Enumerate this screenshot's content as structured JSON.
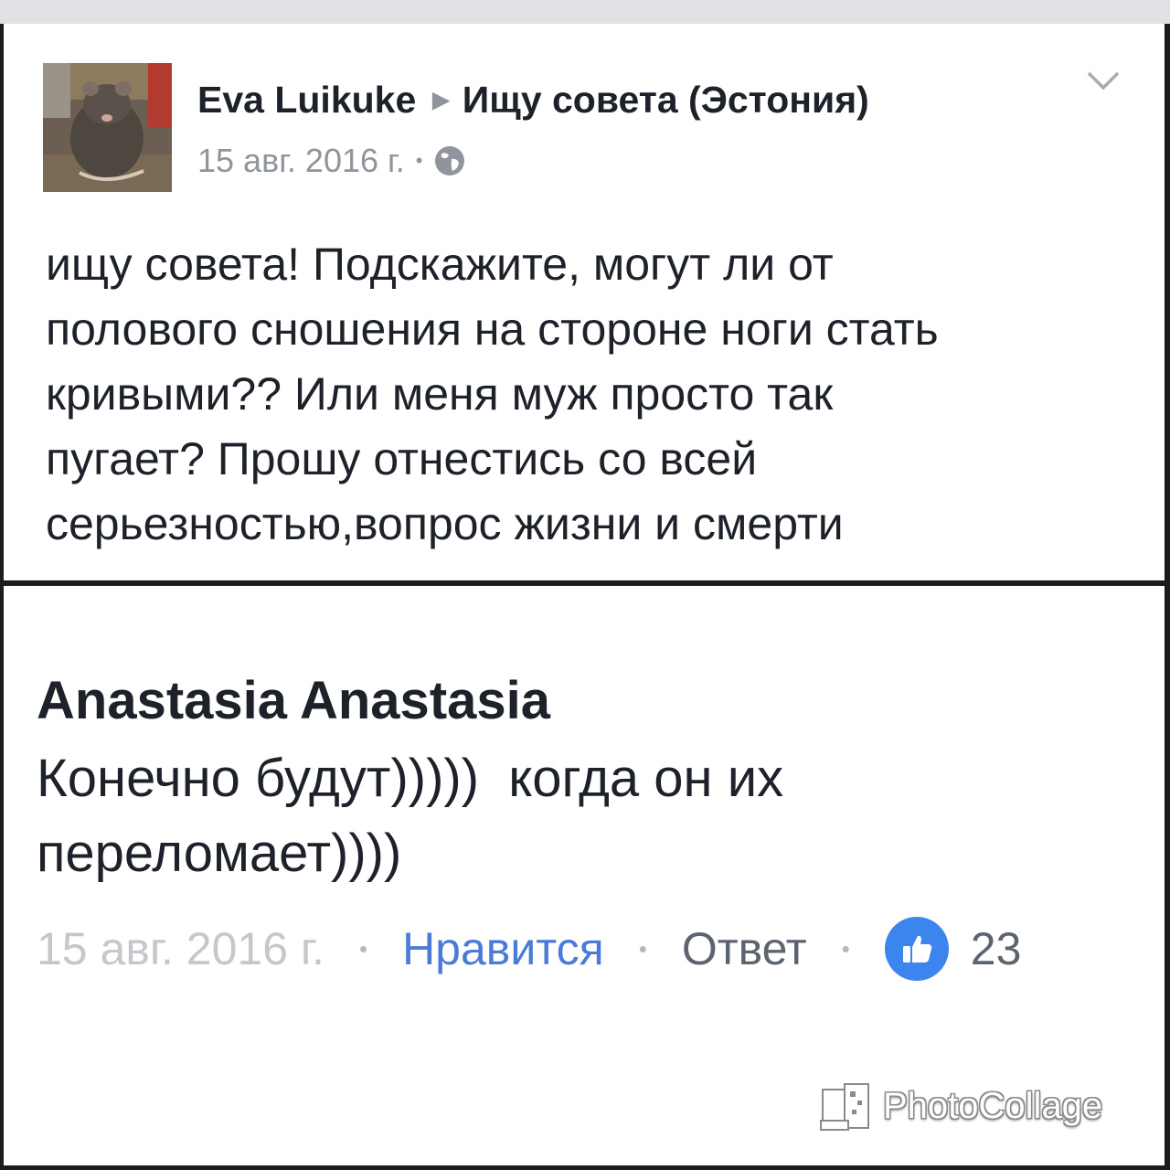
{
  "post": {
    "author": "Eva Luikuke",
    "arrow": "▶",
    "group": "Ищу совета (Эстония)",
    "date": "15 авг. 2016 г.",
    "meta_separator": "•",
    "privacy_icon": "globe-icon",
    "menu_icon": "chevron-down-icon",
    "avatar_icon": "rat-photo",
    "body_lines": [
      "ищу совета! Подскажите, могут ли от",
      "полового сношения на стороне ноги стать",
      "кривыми?? Или меня муж просто так",
      "пугает? Прошу отнестись со всей",
      "серьезностью,вопрос жизни и смерти"
    ]
  },
  "comment": {
    "author": "Anastasia Anastasia",
    "body_lines": [
      "Конечно будут)))))  когда он их",
      "переломает))))"
    ],
    "date": "15 авг. 2016 г.",
    "separator": "•",
    "like_label": "Нравится",
    "reply_label": "Ответ",
    "like_icon": "thumbs-up-icon",
    "like_count": "23"
  },
  "watermark": {
    "text": "PhotoCollage",
    "icon": "collage-logo"
  },
  "colors": {
    "like_blue": "#3d85ee",
    "link_blue": "#4a7bd6",
    "meta_gray": "#90949c",
    "text_dark": "#1d2129"
  }
}
